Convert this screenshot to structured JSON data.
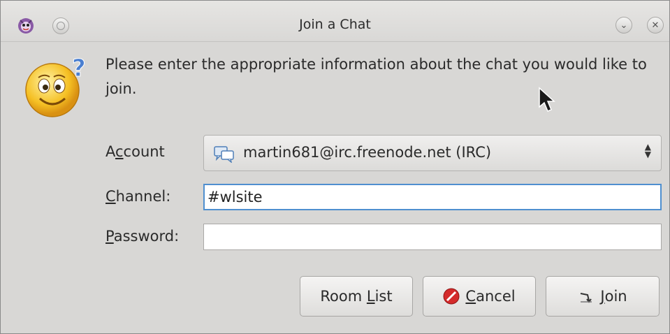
{
  "window": {
    "title": "Join a Chat"
  },
  "message": "Please enter the appropriate information about the chat you would like to join.",
  "form": {
    "account_label_pre": "A",
    "account_label_u": "c",
    "account_label_post": "count",
    "account_value": "martin681@irc.freenode.net (IRC)",
    "channel_label_u": "C",
    "channel_label_post": "hannel:",
    "channel_value": "#wlsite",
    "password_label_u": "P",
    "password_label_post": "assword:",
    "password_value": ""
  },
  "buttons": {
    "room_list_pre": "Room ",
    "room_list_u": "L",
    "room_list_post": "ist",
    "cancel_u": "C",
    "cancel_post": "ancel",
    "join_u": "J",
    "join_post": "oin"
  },
  "icons": {
    "app": "pidgin-icon",
    "dialog": "question-smiley-icon",
    "account": "chat-bubbles-icon",
    "cancel": "stop-icon",
    "join": "join-arrow-icon"
  },
  "colors": {
    "focus_border": "#4f8fcf",
    "cancel_red": "#d42b2b"
  }
}
